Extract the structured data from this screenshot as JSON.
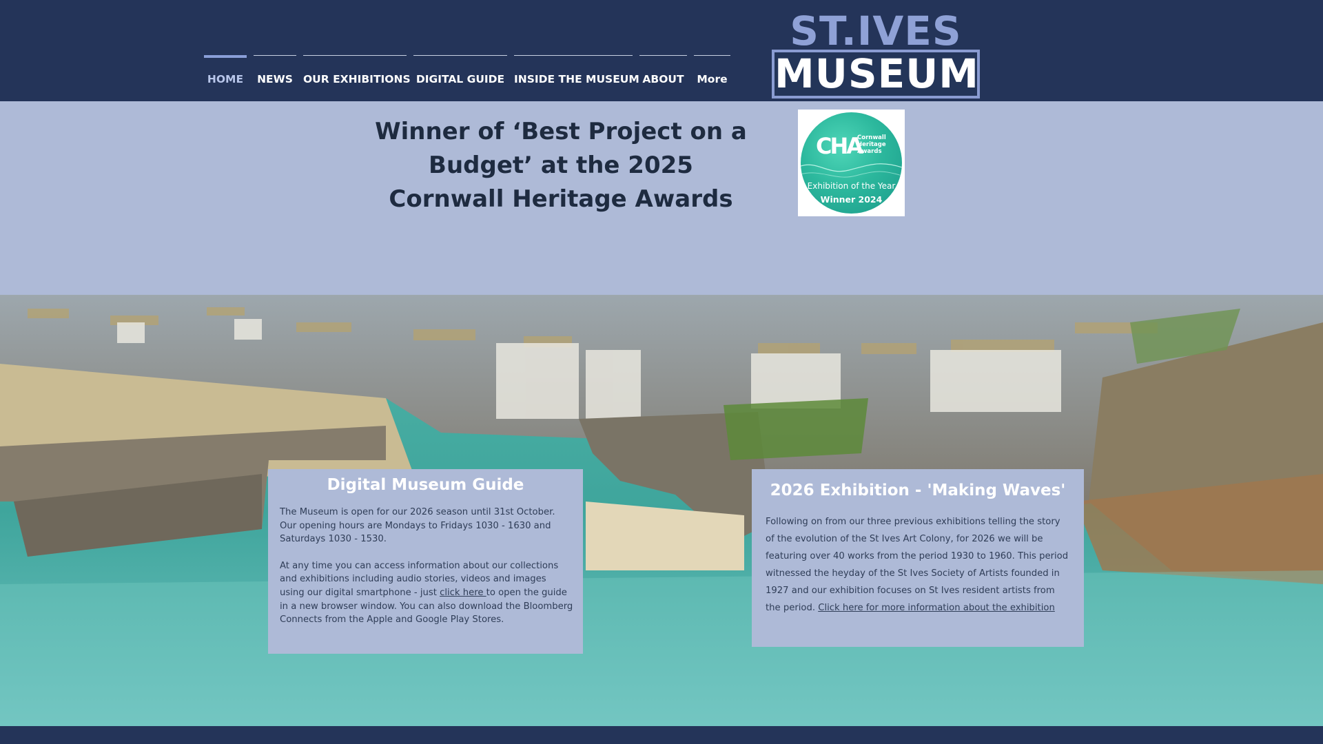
{
  "brand": {
    "logo_top": "ST.IVES",
    "logo_bottom": "MUSEUM",
    "colors": {
      "header_bg": "#243459",
      "accent": "#8a9fd8",
      "strip_bg": "#aebad7",
      "panel_bg": "#aebad7",
      "heading_text": "#1e2b40"
    }
  },
  "nav": {
    "items": [
      {
        "label": "HOME",
        "active": true
      },
      {
        "label": "NEWS"
      },
      {
        "label": "OUR EXHIBITIONS"
      },
      {
        "label": "DIGITAL GUIDE"
      },
      {
        "label": "INSIDE THE MUSEUM"
      },
      {
        "label": "ABOUT"
      },
      {
        "label": "More"
      }
    ]
  },
  "award": {
    "title": "Winner of ‘Best Project on a Budget’ at the 2025 Cornwall Heritage Awards",
    "badge": {
      "mark": "CHA",
      "org_name": "Cornwall Heritage Awards",
      "line1": "Exhibition of the Year",
      "line2": "Winner 2024"
    }
  },
  "hero": {
    "image_icon": "harbour-photo"
  },
  "guide_panel": {
    "heading": "Digital Museum Guide",
    "para1": "The Museum is open for our 2026 season until 31st October. Our opening hours are Mondays to Fridays 1030 - 1630 and Saturdays 1030 - 1530.",
    "para2_before": "At any time you can access information about our collections and exhibitions including audio stories, videos and images using our digital smartphone - just ",
    "para2_link": "click here ",
    "para2_after": "to open the guide in a new browser window.    You can also download the Bloomberg Connects from the Apple and Google Play Stores."
  },
  "exhibition_panel": {
    "heading": "2026 Exhibition - 'Making Waves'",
    "para_before": "Following on from our three previous exhibitions telling the story of the evolution of the St Ives Art Colony, for 2026 we will be featuring over 40 works from the period 1930 to 1960.  This period witnessed the heyday of the St Ives Society of Artists founded in 1927 and our exhibition focuses on St Ives resident artists from the period. ",
    "para_link": "Click here for more information about the exhibition"
  }
}
